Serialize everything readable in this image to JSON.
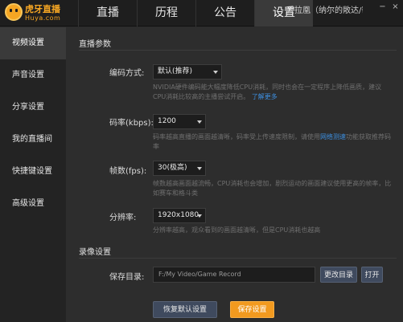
{
  "app": {
    "logo_title": "虎牙直播",
    "logo_sub": "Huya.com",
    "tabs": [
      {
        "label": "直播"
      },
      {
        "label": "历程"
      },
      {
        "label": "公告"
      },
      {
        "label": "设置"
      }
    ],
    "user_text": "丢拉凰（纳尔的敞达/帮…",
    "window": {
      "minimize": "−",
      "close": "×"
    }
  },
  "sidebar": {
    "items": [
      {
        "label": "视频设置"
      },
      {
        "label": "声音设置"
      },
      {
        "label": "分享设置"
      },
      {
        "label": "我的直播间"
      },
      {
        "label": "快捷键设置"
      },
      {
        "label": "高级设置"
      }
    ]
  },
  "main": {
    "live_section": "直播参数",
    "encode": {
      "label": "编码方式:",
      "value": "默认(推荐)",
      "desc": "NVIDIA硬件编码能大幅度降低CPU消耗，同时也会在一定程序上降低画质，建议CPU消耗比较高的主播尝试开启。",
      "link": "了解更多"
    },
    "bitrate": {
      "label": "码率(kbps):",
      "value": "1200",
      "desc": "码率越高直播的画面越清晰，码率受上传速度限制，请使用",
      "link": "网络测速",
      "desc_tail": "功能获取推荐码率"
    },
    "fps": {
      "label": "帧数(fps):",
      "value": "30(极高)",
      "desc": "帧数越高画面越流畅，CPU消耗也会增加，剧烈运动的画面建议使用更高的帧率，比如赛车和格斗类"
    },
    "resolution": {
      "label": "分辨率:",
      "value": "1920x1080",
      "desc": "分辨率越高，观众看到的画面越清晰，但是CPU消耗也越高"
    },
    "record_section": "录像设置",
    "save_dir": {
      "label": "保存目录:",
      "value": "F:/My Video/Game Record",
      "change_btn": "更改目录",
      "open_btn": "打开"
    },
    "restore_btn": "恢复默认设置",
    "save_btn": "保存设置"
  },
  "colors": {
    "accent": "#f29a1f",
    "link": "#3d8fe0",
    "background": "#2d2d2d"
  }
}
